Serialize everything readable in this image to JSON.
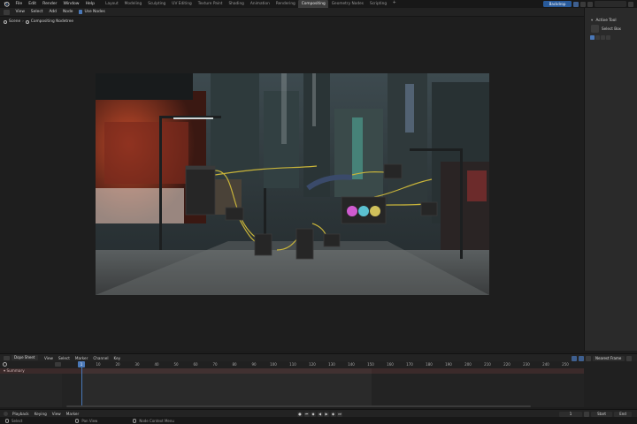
{
  "menubar": {
    "items": [
      "File",
      "Edit",
      "Render",
      "Window",
      "Help"
    ],
    "workspace_tabs": [
      "Layout",
      "Modeling",
      "Sculpting",
      "UV Editing",
      "Texture Paint",
      "Shading",
      "Animation",
      "Rendering",
      "Compositing",
      "Geometry Nodes",
      "Scripting"
    ],
    "active_tab": "Compositing",
    "add_tab": "+",
    "scene": "Backdrop"
  },
  "editor_header": {
    "items": [
      "View",
      "Select",
      "Add",
      "Node"
    ],
    "use_nodes_label": "Use Nodes"
  },
  "breadcrumb": {
    "scene": "Scene",
    "tree": "Compositing Nodetree"
  },
  "side_panel": {
    "section": "Active Tool",
    "tool": "Select Box"
  },
  "timeline": {
    "mode": "Dope Sheet",
    "items": [
      "View",
      "Select",
      "Marker",
      "Channel",
      "Key"
    ],
    "snap": "Nearest Frame",
    "current_frame": "1",
    "ticks": [
      "10",
      "20",
      "30",
      "40",
      "50",
      "60",
      "70",
      "80",
      "90",
      "100",
      "110",
      "120",
      "130",
      "140",
      "150",
      "160",
      "170",
      "180",
      "190",
      "200",
      "210",
      "220",
      "230",
      "240",
      "250"
    ],
    "summary": "Summary"
  },
  "playback": {
    "items": [
      "Playback",
      "Keying",
      "View",
      "Marker"
    ],
    "start_frame": "1",
    "start_label": "Start",
    "end_label": "End"
  },
  "status": {
    "select": "Select",
    "pan": "Pan View",
    "context": "Node Context Menu"
  },
  "colors": {
    "accent": "#4a78b8",
    "node_wire": "#c8b43a"
  }
}
